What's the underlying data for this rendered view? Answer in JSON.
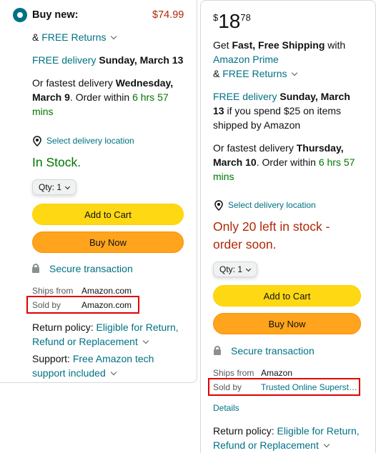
{
  "left": {
    "buy_new_label": "Buy new:",
    "price": "$74.99",
    "returns_prefix": "& ",
    "returns_link": "FREE Returns",
    "delivery_link": "FREE delivery",
    "delivery_date": "Sunday, March 13",
    "fastest_prefix": "Or fastest delivery",
    "fastest_date_line1": "Wednesday,",
    "fastest_date_line2": "March 9",
    "order_within": ". Order within",
    "countdown_line1": "6 hrs 57",
    "countdown_line2": "mins",
    "location_link": "Select delivery location",
    "stock": "In Stock.",
    "qty_label": "Qty: 1",
    "add_to_cart": "Add to Cart",
    "buy_now": "Buy Now",
    "secure": "Secure transaction",
    "ships_from_label": "Ships from",
    "ships_from_value": "Amazon.com",
    "sold_by_label": "Sold by",
    "sold_by_value": "Amazon.com",
    "return_policy_label": "Return policy:",
    "return_policy_link_line1": "Eligible for Return,",
    "return_policy_link_line2": "Refund or Replacement",
    "support_label": "Support:",
    "support_link_line1": "Free Amazon tech",
    "support_link_line2": "support included"
  },
  "right": {
    "price_symbol": "$",
    "price_whole": "18",
    "price_fraction": "78",
    "get_text": "Get",
    "fast_shipping": "Fast, Free Shipping",
    "with_text": "with",
    "prime_link": "Amazon Prime",
    "returns_prefix": "& ",
    "returns_link": "FREE Returns",
    "delivery_link": "FREE delivery",
    "delivery_date_line1": "Sunday, March",
    "delivery_date_line2": "13",
    "delivery_condition_line2": "if you spend $25 on items",
    "delivery_condition_line3": "shipped by Amazon",
    "fastest_prefix": "Or fastest delivery",
    "fastest_date_line1": "Thursday,",
    "fastest_date_line2": "March 10",
    "order_within": ". Order within",
    "countdown_line1": "6 hrs 57",
    "countdown_line2": "mins",
    "location_link": "Select delivery location",
    "stock_line1": "Only 20 left in stock -",
    "stock_line2": "order soon.",
    "qty_label": "Qty: 1",
    "add_to_cart": "Add to Cart",
    "buy_now": "Buy Now",
    "secure": "Secure transaction",
    "ships_from_label": "Ships from",
    "ships_from_value": "Amazon",
    "sold_by_label": "Sold by",
    "sold_by_value": "Trusted Online Superst…",
    "details_link": "Details",
    "return_policy_label": "Return policy:",
    "return_policy_link_line1": "Eligible for Return,",
    "return_policy_link_line2": "Refund or Replacement"
  },
  "colors": {
    "link": "#007185",
    "in_stock": "#007600",
    "low_stock": "#B12704",
    "add_to_cart": "#FFD814",
    "buy_now": "#FFA41C",
    "highlight_box": "#E00000"
  }
}
